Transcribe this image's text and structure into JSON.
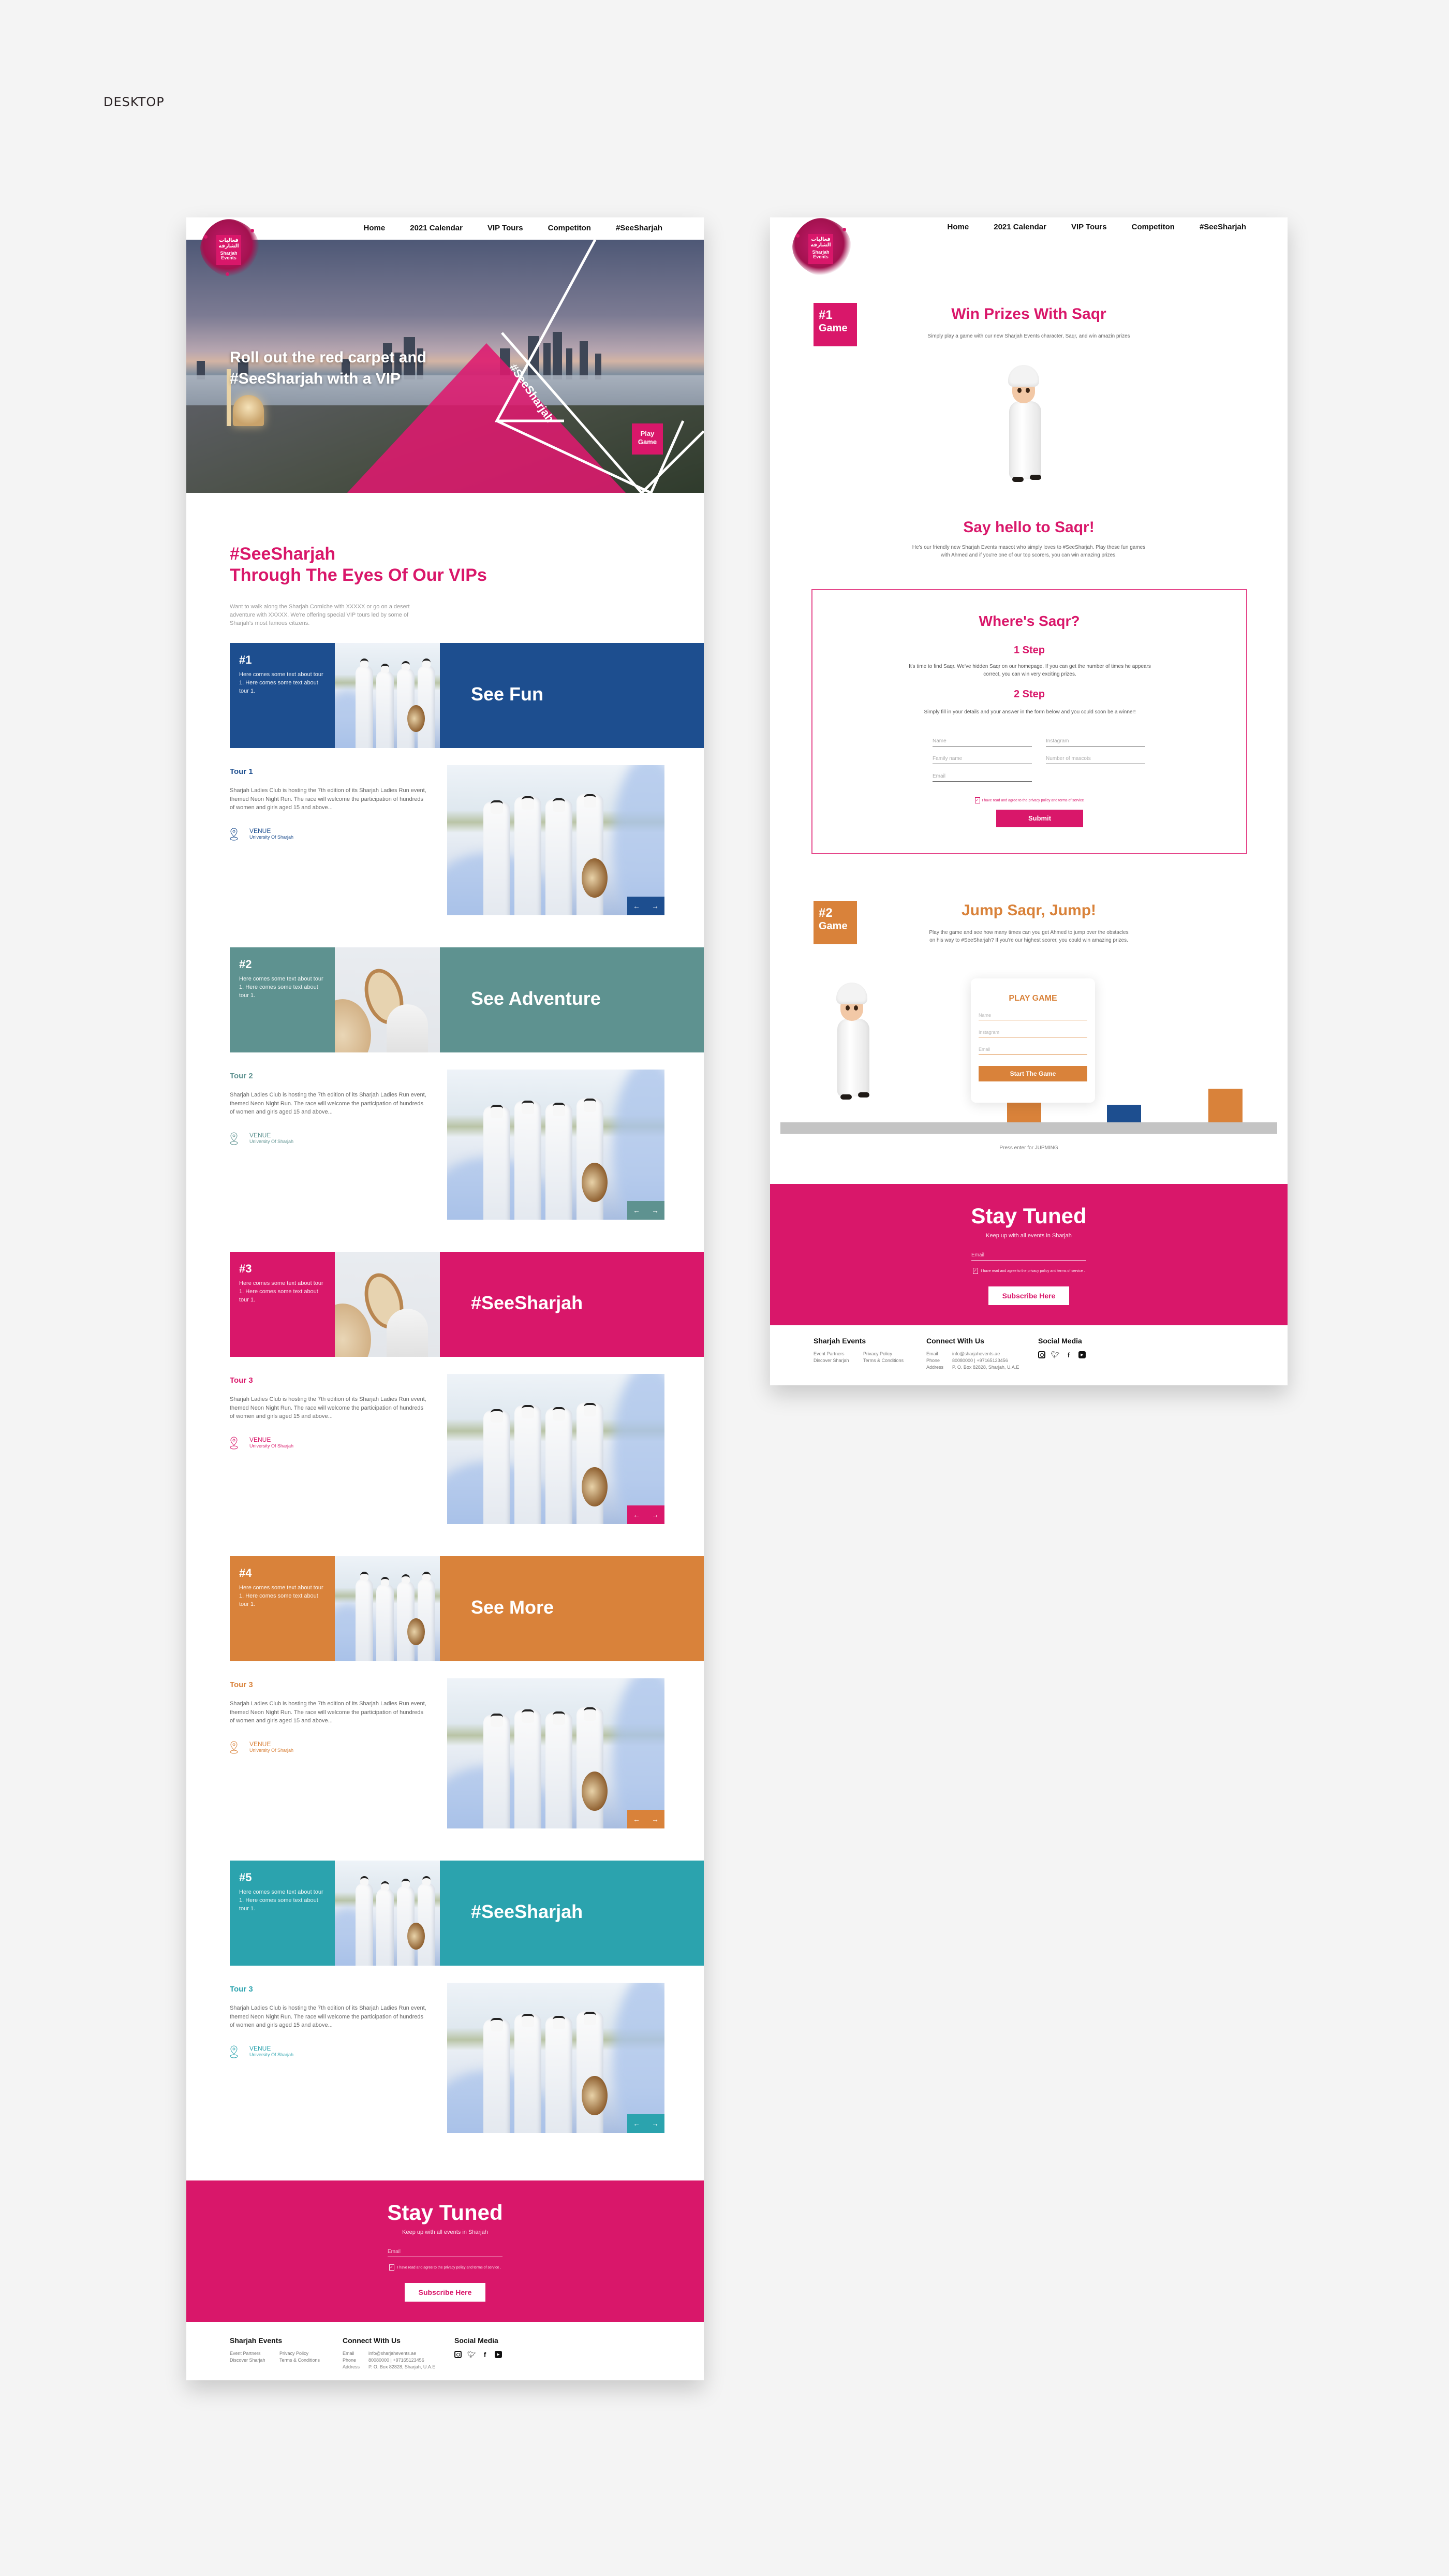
{
  "canvas_label": "DESKTOP",
  "colors": {
    "brand_pink": "#d9176a",
    "tour_blue": "#1d4e8f",
    "tour_teal": "#5e9290",
    "tour_pink": "#d9176a",
    "tour_orange": "#d9823a",
    "tour_cyan": "#2ba3ae",
    "game_orange": "#d9823a"
  },
  "nav": {
    "logo_arabic": "فعاليات الشارقة",
    "logo_english": "Sharjah Events",
    "items": [
      "Home",
      "2021 Calendar",
      "VIP Tours",
      "Competiton",
      "#SeeSharjah"
    ]
  },
  "hero": {
    "title_line1": "Roll out the red carpet and",
    "title_line2": "#SeeSharjah with a VIP",
    "tag": "#SeeSharjah",
    "play_button_line1": "Play",
    "play_button_line2": "Game"
  },
  "intro": {
    "title_line1": "#SeeSharjah",
    "title_line2": "Through The Eyes Of Our VIPs",
    "text": "Want to walk along the Sharjah Corniche with XXXXX or go on a desert adventure with XXXXX. We're offering special VIP tours led by some of Sharjah's most famous citizens."
  },
  "tours": [
    {
      "num": "#1",
      "blurb": "Here comes some text about tour 1. Here comes some text about tour 1.",
      "headline": "See Fun",
      "name": "Tour 1",
      "desc": "Sharjah Ladies Club is hosting the 7th edition of its Sharjah Ladies Run event, themed Neon Night Run. The race will welcome the participation of hundreds of women and girls aged 15 and above...",
      "venue_label": "VENUE",
      "venue": "University Of Sharjah",
      "color": "#1d4e8f",
      "banner_photo": "people"
    },
    {
      "num": "#2",
      "blurb": "Here comes some text about tour 1. Here comes some text about tour 1.",
      "headline": "See Adventure",
      "name": "Tour 2",
      "desc": "Sharjah Ladies Club is hosting the 7th edition of its Sharjah Ladies Run event, themed Neon Night Run. The race will welcome the participation of hundreds of women and girls aged 15 and above...",
      "venue_label": "VENUE",
      "venue": "University Of Sharjah",
      "color": "#5e9290",
      "banner_photo": "tambourine"
    },
    {
      "num": "#3",
      "blurb": "Here comes some text about tour 1. Here comes some text about tour 1.",
      "headline": "#SeeSharjah",
      "name": "Tour 3",
      "desc": "Sharjah Ladies Club is hosting the 7th edition of its Sharjah Ladies Run event, themed Neon Night Run. The race will welcome the participation of hundreds of women and girls aged 15 and above...",
      "venue_label": "VENUE",
      "venue": "University Of Sharjah",
      "color": "#d9176a",
      "banner_photo": "tambourine"
    },
    {
      "num": "#4",
      "blurb": "Here comes some text about tour 1. Here comes some text about tour 1.",
      "headline": "See More",
      "name": "Tour 3",
      "desc": "Sharjah Ladies Club is hosting the 7th edition of its Sharjah Ladies Run event, themed Neon Night Run. The race will welcome the participation of hundreds of women and girls aged 15 and above...",
      "venue_label": "VENUE",
      "venue": "University Of Sharjah",
      "color": "#d9823a",
      "banner_photo": "people"
    },
    {
      "num": "#5",
      "blurb": "Here comes some text about tour 1. Here comes some text about tour 1.",
      "headline": "#SeeSharjah",
      "name": "Tour 3",
      "desc": "Sharjah Ladies Club is hosting the 7th edition of its Sharjah Ladies Run event, themed Neon Night Run. The race will welcome the participation of hundreds of women and girls aged 15 and above...",
      "venue_label": "VENUE",
      "venue": "University Of Sharjah",
      "color": "#2ba3ae",
      "banner_photo": "people"
    }
  ],
  "gallery_nav": {
    "prev": "←",
    "next": "→"
  },
  "stay_tuned": {
    "title": "Stay Tuned",
    "subtitle": "Keep up with all events in Sharjah",
    "email_placeholder": "Email",
    "agree_text": "I have read and agree to the privacy policy and terms of service .",
    "button": "Subscribe Here"
  },
  "footer": {
    "col1_title": "Sharjah Events",
    "col1_links": [
      "Event Partners",
      "Privacy Policy",
      "Discover Sharjah",
      "Terms & Conditions"
    ],
    "col2_title": "Connect With Us",
    "contact": [
      {
        "label": "Email",
        "value": "info@sharjahevents.ae"
      },
      {
        "label": "Phone",
        "value": "80080000 | +97165123456"
      },
      {
        "label": "Address",
        "value": "P. O. Box 82828, Sharjah, U.A.E"
      }
    ],
    "col3_title": "Social Media",
    "social_icons": [
      "instagram-icon",
      "twitter-icon",
      "facebook-icon",
      "youtube-icon"
    ]
  },
  "competition": {
    "game1": {
      "badge_num": "#1",
      "badge_label": "Game",
      "title": "Win Prizes With Saqr",
      "subtitle": "Simply play a game with our new Sharjah Events character, Saqr, and win amazin prizes",
      "hello_title": "Say hello to Saqr!",
      "hello_text": "He's our friendly new Sharjah Events mascot who simply loves to #SeeSharjah. Play these fun games with Ahmed and if you're one of our top scorers, you can win amazing prizes."
    },
    "wheres_saqr": {
      "title": "Where's Saqr?",
      "step1_title": "1 Step",
      "step1_text": "It's time to find Saqr. We've hidden Saqr on our homepage. If you can get the number of times he appears correct, you can win very exciting prizes.",
      "step2_title": "2 Step",
      "step2_text": "Simply fill in your details and your answer in the form below and you could soon be a winner!",
      "fields": {
        "name": "Name",
        "instagram": "Instagram",
        "family_name": "Family name",
        "mascots": "Number of mascots",
        "email": "Email"
      },
      "agree_text": "I have read and agree to the privacy policy and terms of service",
      "submit": "Submit"
    },
    "game2": {
      "badge_num": "#2",
      "badge_label": "Game",
      "title": "Jump Saqr, Jump!",
      "text": "Play the game and see how many times can you get Ahmed to jump over the obstacles on his way to #SeeSharjah? If you're our highest scorer, you could win amazing prizes.",
      "card_title": "PLAY GAME",
      "fields": {
        "name": "Name",
        "instagram": "Instagram",
        "email": "Email"
      },
      "start_button": "Start The Game",
      "hint": "Press enter for JUPMING"
    }
  }
}
